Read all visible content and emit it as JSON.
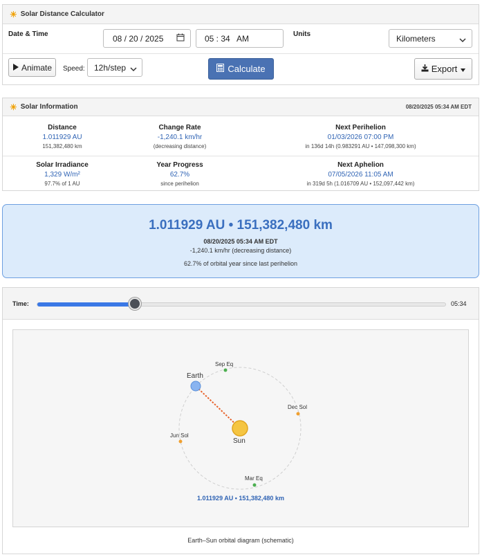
{
  "calculator": {
    "title": "Solar Distance Calculator",
    "date_time_label": "Date & Time",
    "date_value": "08 / 20 / 2025",
    "time_value": "05 : 34   AM",
    "units_label": "Units",
    "units_value": "Kilometers",
    "animate_label": "Animate",
    "speed_label": "Speed:",
    "speed_value": "12h/step",
    "calculate_label": "Calculate",
    "export_label": "Export"
  },
  "info": {
    "title": "Solar Information",
    "timestamp": "08/20/2025 05:34 AM EDT",
    "distance": {
      "title": "Distance",
      "value": "1.011929 AU",
      "sub": "151,382,480 km"
    },
    "change_rate": {
      "title": "Change Rate",
      "value": "-1,240.1 km/hr",
      "sub": "(decreasing distance)"
    },
    "perihelion": {
      "title": "Next Perihelion",
      "value": "01/03/2026 07:00 PM",
      "sub": "in 136d 14h (0.983291 AU • 147,098,300 km)"
    },
    "irradiance": {
      "title": "Solar Irradiance",
      "value": "1,329 W/m²",
      "sub": "97.7% of 1 AU"
    },
    "year_progress": {
      "title": "Year Progress",
      "value": "62.7%",
      "sub": "since perihelion"
    },
    "aphelion": {
      "title": "Next Aphelion",
      "value": "07/05/2026 11:05 AM",
      "sub": "in 319d 5h (1.016709 AU • 152,097,442 km)"
    }
  },
  "summary": {
    "headline": "1.011929 AU • 151,382,480 km",
    "datetime": "08/20/2025 05:34 AM EDT",
    "rate": "-1,240.1 km/hr (decreasing distance)",
    "progress": "62.7% of orbital year since last perihelion"
  },
  "timeline": {
    "label": "Time:",
    "time_display": "05:34",
    "position_fraction": 0.24
  },
  "diagram": {
    "earth_label": "Earth",
    "sun_label": "Sun",
    "markers": {
      "sep": "Sep Eq",
      "dec": "Dec Sol",
      "mar": "Mar Eq",
      "jun": "Jun Sol"
    },
    "distance_label": "1.011929 AU • 151,382,480 km",
    "caption": "Earth–Sun orbital diagram (schematic)"
  },
  "colors": {
    "accent_blue": "#2f63b4",
    "primary_button": "#4a72b3",
    "summary_bg": "#dcebfb",
    "sun": "#f5c542",
    "earth": "#8ab4f0",
    "equinox": "#4caf50",
    "solstice": "#f0a030",
    "link_line": "#e8622a"
  },
  "icons": [
    "sun-icon",
    "calendar-icon",
    "play-icon",
    "calculator-icon",
    "download-icon",
    "chevron-down-icon"
  ]
}
